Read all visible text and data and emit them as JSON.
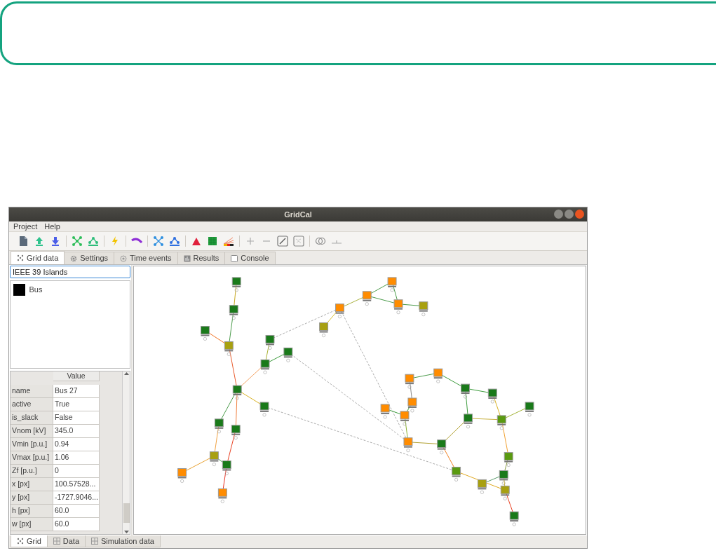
{
  "window": {
    "title": "GridCal"
  },
  "menu": [
    "Project",
    "Help"
  ],
  "toolbar": [
    {
      "kind": "file"
    },
    {
      "kind": "upload"
    },
    {
      "kind": "download"
    },
    {
      "kind": "sep"
    },
    {
      "kind": "net"
    },
    {
      "kind": "net2"
    },
    {
      "kind": "sep"
    },
    {
      "kind": "bolt"
    },
    {
      "kind": "sep"
    },
    {
      "kind": "curve"
    },
    {
      "kind": "sep"
    },
    {
      "kind": "net3"
    },
    {
      "kind": "net4"
    },
    {
      "kind": "sep"
    },
    {
      "kind": "tri"
    },
    {
      "kind": "block"
    },
    {
      "kind": "fan"
    },
    {
      "kind": "sep"
    },
    {
      "kind": "plus"
    },
    {
      "kind": "minus"
    },
    {
      "kind": "boxline"
    },
    {
      "kind": "boxmap"
    },
    {
      "kind": "sep"
    },
    {
      "kind": "rings"
    },
    {
      "kind": "ground"
    }
  ],
  "tabs": [
    {
      "label": "Grid data",
      "kind": "dots",
      "selected": true
    },
    {
      "label": "Settings",
      "kind": "gear",
      "selected": false
    },
    {
      "label": "Time events",
      "kind": "clock",
      "selected": false
    },
    {
      "label": "Results",
      "kind": "bars",
      "selected": false
    },
    {
      "label": "Console",
      "kind": "console",
      "selected": false
    }
  ],
  "grid_name": {
    "value": "IEEE 39 Islands"
  },
  "object_types": [
    {
      "label": "Bus",
      "color": "#000000"
    }
  ],
  "properties": {
    "column": "Value",
    "rows": [
      {
        "name": "name",
        "value": "Bus 27"
      },
      {
        "name": "active",
        "value": "True"
      },
      {
        "name": "is_slack",
        "value": "False"
      },
      {
        "name": "Vnom [kV]",
        "value": "345.0"
      },
      {
        "name": "Vmin [p.u.]",
        "value": "0.94"
      },
      {
        "name": "Vmax [p.u.]",
        "value": "1.06"
      },
      {
        "name": "Zf [p.u.]",
        "value": "0"
      },
      {
        "name": "x [px]",
        "value": "100.57528..."
      },
      {
        "name": "y [px]",
        "value": "-1727.9046..."
      },
      {
        "name": "h [px]",
        "value": "60.0"
      },
      {
        "name": "w [px]",
        "value": "60.0"
      }
    ]
  },
  "bottom_tabs": [
    {
      "label": "Grid",
      "kind": "dots",
      "selected": true
    },
    {
      "label": "Data",
      "kind": "table",
      "selected": false
    },
    {
      "label": "Simulation data",
      "kind": "table",
      "selected": false
    }
  ]
}
